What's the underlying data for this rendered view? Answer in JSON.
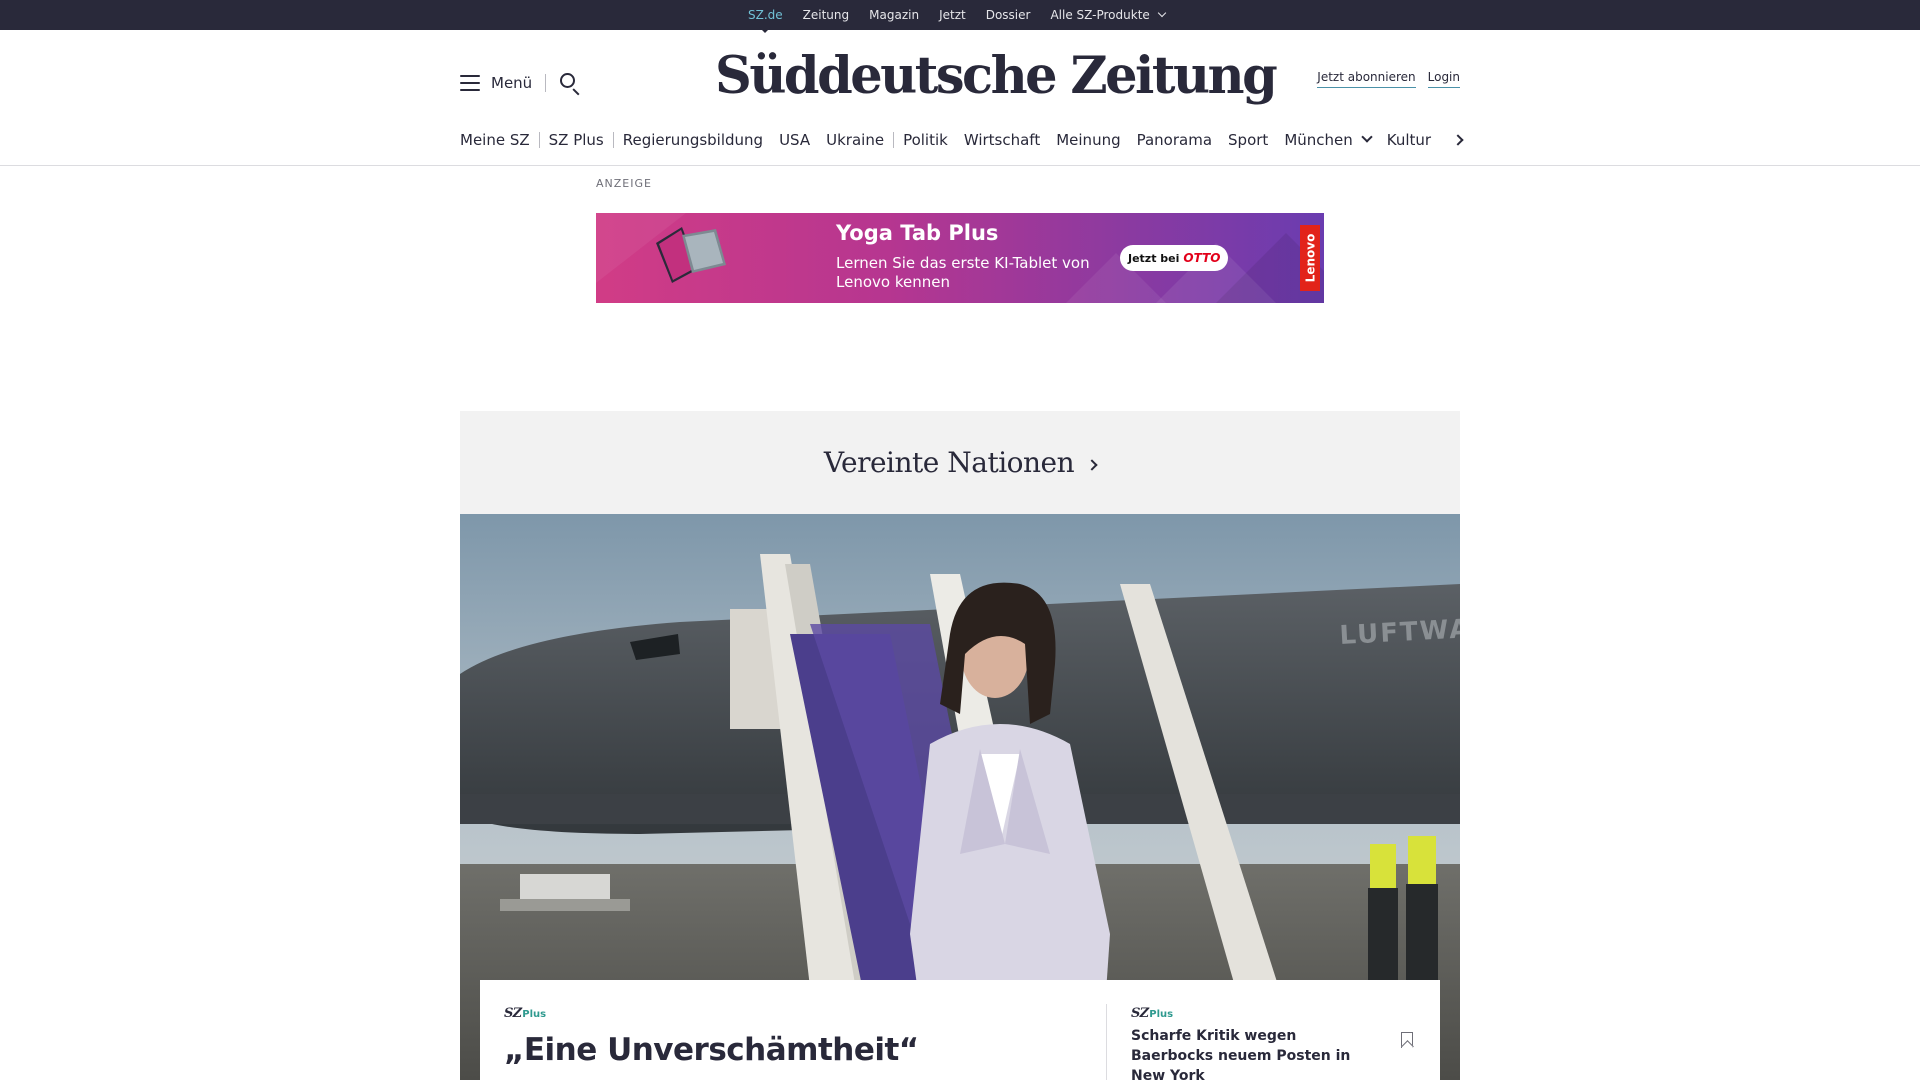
{
  "topbar": {
    "items": [
      {
        "label": "SZ.de",
        "active": true
      },
      {
        "label": "Zeitung"
      },
      {
        "label": "Magazin"
      },
      {
        "label": "Jetzt"
      },
      {
        "label": "Dossier"
      },
      {
        "label": "Alle SZ-Produkte",
        "icon": "chevron-down-icon"
      }
    ]
  },
  "header": {
    "menu_label": "Menü",
    "logo": "Süddeutsche Zeitung",
    "subscribe_label": "Jetzt abonnieren",
    "login_label": "Login"
  },
  "nav": {
    "items": [
      "Meine SZ",
      "SZ Plus",
      "Regierungsbildung",
      "USA",
      "Ukraine",
      "Politik",
      "Wirtschaft",
      "Meinung",
      "Panorama",
      "Sport",
      "München",
      "Kultur"
    ]
  },
  "ad": {
    "label": "ANZEIGE",
    "title": "Yoga Tab Plus",
    "text": "Lernen Sie das erste KI-Tablet von Lenovo kennen",
    "cta_prefix": "Jetzt bei",
    "cta_brand": "OTTO",
    "brand": "Lenovo"
  },
  "section": {
    "title": "Vereinte Nationen"
  },
  "hero": {
    "plane_lettering": "LUFTWAFFE"
  },
  "teaser_main": {
    "badge_sz": "SZ",
    "badge_plus": "Plus",
    "headline": "„Eine Unverschämtheit“"
  },
  "teaser_side": {
    "badge_sz": "SZ",
    "badge_plus": "Plus",
    "headline": "Scharfe Kritik wegen Baerbocks neuem Posten in New York"
  },
  "colors": {
    "topbar_bg": "#29293a",
    "accent_active": "#71c1d6",
    "plus_green": "#2f9a8f",
    "section_band": "#f2f2f2"
  }
}
